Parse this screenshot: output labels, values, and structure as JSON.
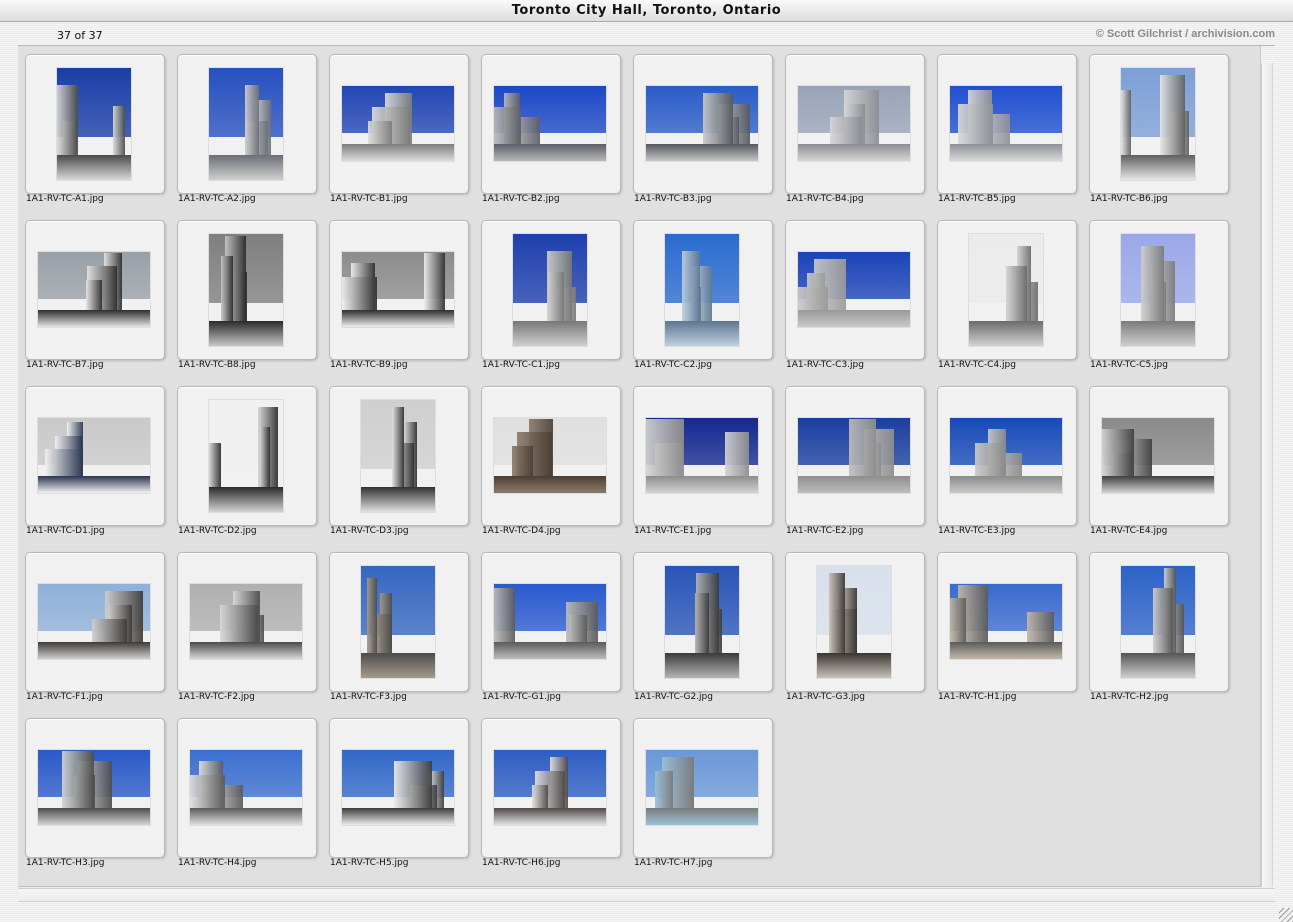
{
  "window": {
    "title": "Toronto City Hall, Toronto, Ontario",
    "counter": "37 of 37",
    "copyright": "© Scott Gilchrist / archivision.com"
  },
  "thumbnails": [
    {
      "label": "1A1-RV-TC-A1.jpg",
      "orientation": "portrait",
      "palette": [
        "#1a3ea8",
        "#d9d9d9",
        "#4a4a4a"
      ]
    },
    {
      "label": "1A1-RV-TC-A2.jpg",
      "orientation": "portrait",
      "palette": [
        "#2750c0",
        "#cfcfcf",
        "#6b6f78"
      ]
    },
    {
      "label": "1A1-RV-TC-B1.jpg",
      "orientation": "landscape",
      "palette": [
        "#2246b4",
        "#dcdcdc",
        "#7c7c7c"
      ]
    },
    {
      "label": "1A1-RV-TC-B2.jpg",
      "orientation": "landscape",
      "palette": [
        "#1c48c6",
        "#b9b9b9",
        "#5b5e68"
      ]
    },
    {
      "label": "1A1-RV-TC-B3.jpg",
      "orientation": "landscape",
      "palette": [
        "#2a5cc8",
        "#c8c8c8",
        "#54585f"
      ]
    },
    {
      "label": "1A1-RV-TC-B4.jpg",
      "orientation": "landscape",
      "palette": [
        "#99a3b8",
        "#d6d6d6",
        "#8a8d94"
      ]
    },
    {
      "label": "1A1-RV-TC-B5.jpg",
      "orientation": "landscape",
      "palette": [
        "#1f4fd0",
        "#d9d9d9",
        "#8d9099"
      ]
    },
    {
      "label": "1A1-RV-TC-B6.jpg",
      "orientation": "portrait",
      "palette": [
        "#7d9fd6",
        "#e6e6e6",
        "#5f5f5f"
      ]
    },
    {
      "label": "1A1-RV-TC-B7.jpg",
      "orientation": "landscape",
      "palette": [
        "#9aa0a8",
        "#e5e5e5",
        "#2e2e2e"
      ]
    },
    {
      "label": "1A1-RV-TC-B8.jpg",
      "orientation": "portrait",
      "palette": [
        "#7f7f7f",
        "#c7c7c7",
        "#2a2a2a"
      ]
    },
    {
      "label": "1A1-RV-TC-B9.jpg",
      "orientation": "landscape",
      "palette": [
        "#8c8c8c",
        "#efefef",
        "#2f2f2f"
      ]
    },
    {
      "label": "1A1-RV-TC-C1.jpg",
      "orientation": "portrait",
      "palette": [
        "#1e3fae",
        "#cfcfcf",
        "#777777"
      ]
    },
    {
      "label": "1A1-RV-TC-C2.jpg",
      "orientation": "portrait",
      "palette": [
        "#2b6bd0",
        "#bfcfe0",
        "#5d7790"
      ]
    },
    {
      "label": "1A1-RV-TC-C3.jpg",
      "orientation": "landscape",
      "palette": [
        "#1a43b8",
        "#c9c9c9",
        "#9a9a9a"
      ]
    },
    {
      "label": "1A1-RV-TC-C4.jpg",
      "orientation": "portrait",
      "palette": [
        "#ebebeb",
        "#d2d2d2",
        "#6b6b6b"
      ]
    },
    {
      "label": "1A1-RV-TC-C5.jpg",
      "orientation": "portrait",
      "palette": [
        "#9aa8e8",
        "#cfcfcf",
        "#7b7b7b"
      ]
    },
    {
      "label": "1A1-RV-TC-D1.jpg",
      "orientation": "landscape",
      "palette": [
        "#c9c9c9",
        "#f2f2f2",
        "#2a3550"
      ]
    },
    {
      "label": "1A1-RV-TC-D2.jpg",
      "orientation": "portrait",
      "palette": [
        "#f0f0f0",
        "#d4d4d4",
        "#2a2a2a"
      ]
    },
    {
      "label": "1A1-RV-TC-D3.jpg",
      "orientation": "portrait",
      "palette": [
        "#cfcfcf",
        "#e2e2e2",
        "#303030"
      ]
    },
    {
      "label": "1A1-RV-TC-D4.jpg",
      "orientation": "landscape",
      "palette": [
        "#e0e0e0",
        "#8c7c6c",
        "#4a3e34"
      ]
    },
    {
      "label": "1A1-RV-TC-E1.jpg",
      "orientation": "landscape",
      "palette": [
        "#14288f",
        "#d3d3d3",
        "#8d8d8d"
      ]
    },
    {
      "label": "1A1-RV-TC-E2.jpg",
      "orientation": "landscape",
      "palette": [
        "#1a3ea0",
        "#bdbdbd",
        "#8e8e8e"
      ]
    },
    {
      "label": "1A1-RV-TC-E3.jpg",
      "orientation": "landscape",
      "palette": [
        "#174ab8",
        "#cacaca",
        "#8a8a8a"
      ]
    },
    {
      "label": "1A1-RV-TC-E4.jpg",
      "orientation": "landscape",
      "palette": [
        "#8a8a8a",
        "#d4d4d4",
        "#3f3f3f"
      ]
    },
    {
      "label": "1A1-RV-TC-F1.jpg",
      "orientation": "landscape",
      "palette": [
        "#8fb0d8",
        "#cfcfcf",
        "#3e3a36"
      ]
    },
    {
      "label": "1A1-RV-TC-F2.jpg",
      "orientation": "landscape",
      "palette": [
        "#b0b0b0",
        "#d8d8d8",
        "#4a4a4a"
      ]
    },
    {
      "label": "1A1-RV-TC-F3.jpg",
      "orientation": "portrait",
      "palette": [
        "#3567c0",
        "#a59a8a",
        "#4c4c4c"
      ]
    },
    {
      "label": "1A1-RV-TC-G1.jpg",
      "orientation": "landscape",
      "palette": [
        "#2a5ad0",
        "#bdbdbd",
        "#5a5a5a"
      ]
    },
    {
      "label": "1A1-RV-TC-G2.jpg",
      "orientation": "portrait",
      "palette": [
        "#2855b8",
        "#b5b5b5",
        "#3a3a3a"
      ]
    },
    {
      "label": "1A1-RV-TC-G3.jpg",
      "orientation": "portrait",
      "palette": [
        "#d8e0ec",
        "#c7c2b8",
        "#3a3530"
      ]
    },
    {
      "label": "1A1-RV-TC-H1.jpg",
      "orientation": "landscape",
      "palette": [
        "#3a6ad0",
        "#c2b8a8",
        "#5a5a5a"
      ]
    },
    {
      "label": "1A1-RV-TC-H2.jpg",
      "orientation": "portrait",
      "palette": [
        "#2d62c8",
        "#cfcfcf",
        "#555555"
      ]
    },
    {
      "label": "1A1-RV-TC-H3.jpg",
      "orientation": "landscape",
      "palette": [
        "#2a5ac8",
        "#d4d4d4",
        "#4c4c4c"
      ]
    },
    {
      "label": "1A1-RV-TC-H4.jpg",
      "orientation": "landscape",
      "palette": [
        "#3b6fd0",
        "#e0e0e0",
        "#5a5a5a"
      ]
    },
    {
      "label": "1A1-RV-TC-H5.jpg",
      "orientation": "landscape",
      "palette": [
        "#3268c8",
        "#ececec",
        "#3c3c3c"
      ]
    },
    {
      "label": "1A1-RV-TC-H6.jpg",
      "orientation": "landscape",
      "palette": [
        "#2d5dc4",
        "#e2e2e2",
        "#504a48"
      ]
    },
    {
      "label": "1A1-RV-TC-H7.jpg",
      "orientation": "landscape",
      "palette": [
        "#6a98d8",
        "#9cc0d8",
        "#7a7a7a"
      ]
    }
  ]
}
